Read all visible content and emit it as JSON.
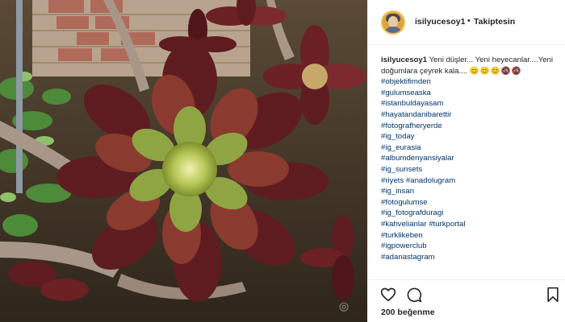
{
  "post": {
    "username": "isilyucesoy1",
    "follow_separator": "•",
    "follow_status": "Takiptesin",
    "caption_text": "Yeni düşler... Yeni heyecanlar....Yeni doğumlara çeyrek kala....",
    "caption_emoji": "😊😊😊🚳🚳",
    "hashtags": [
      "#objektifimden",
      "#gulumseaska",
      "#istanbuldayasam",
      "#hayatandanibarettir",
      "#fotografheryerde",
      "#ig_today",
      "#ig_eurasia",
      "#albumdenyansiyalar",
      "#ig_sunsets",
      "#riyets #anadolugram",
      "#ig_insan",
      "#fotogulumse",
      "#ig_fotografduragi",
      "#kahvelianlar #turkportal",
      "#turklikeben",
      "#igpowerclub",
      "#adanastagram"
    ],
    "likes": "200 beğenme"
  },
  "icons": {
    "like": "heart-icon",
    "comment": "comment-bubble-icon",
    "save": "bookmark-icon"
  },
  "colors": {
    "hashtag": "#003569",
    "text": "#262626",
    "border": "#efefef"
  }
}
